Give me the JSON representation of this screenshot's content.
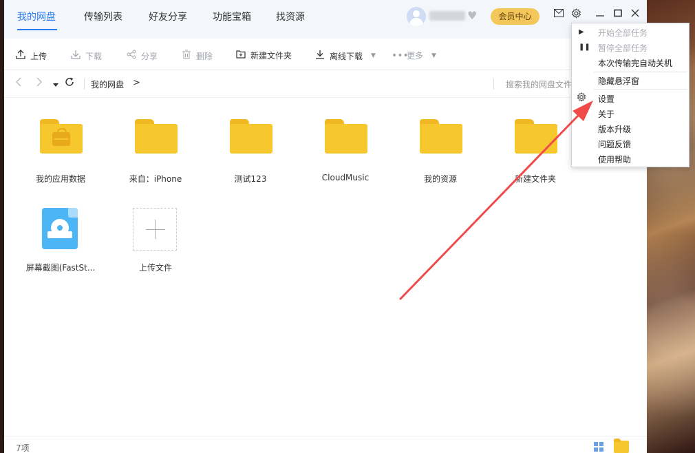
{
  "nav": {
    "tabs": [
      {
        "label": "我的网盘"
      },
      {
        "label": "传输列表"
      },
      {
        "label": "好友分享"
      },
      {
        "label": "功能宝箱"
      },
      {
        "label": "找资源"
      }
    ],
    "member_center": "会员中心"
  },
  "toolbar": {
    "upload": "上传",
    "download": "下载",
    "share": "分享",
    "delete": "删除",
    "new_folder": "新建文件夹",
    "offline_download": "离线下载",
    "more": "更多"
  },
  "pathbar": {
    "crumb": "我的网盘",
    "crumb_arrow": ">",
    "search_placeholder": "搜索我的网盘文件"
  },
  "files": [
    {
      "name": "我的应用数据",
      "type": "app-folder"
    },
    {
      "name": "来自：iPhone",
      "type": "folder"
    },
    {
      "name": "测试123",
      "type": "folder"
    },
    {
      "name": "CloudMusic",
      "type": "folder"
    },
    {
      "name": "我的资源",
      "type": "folder"
    },
    {
      "name": "新建文件夹",
      "type": "folder"
    },
    {
      "name": "屏幕截图(FastSt...",
      "type": "file"
    },
    {
      "name": "上传文件",
      "type": "upload"
    }
  ],
  "status": {
    "count": "7项"
  },
  "menu": {
    "items": [
      {
        "label": "开始全部任务",
        "disabled": true
      },
      {
        "label": "暂停全部任务",
        "disabled": true
      },
      {
        "label": "本次传输完自动关机",
        "disabled": false
      },
      {
        "label": "隐藏悬浮窗",
        "disabled": false
      },
      {
        "label": "设置",
        "disabled": false
      },
      {
        "label": "关于",
        "disabled": false
      },
      {
        "label": "版本升级",
        "disabled": false
      },
      {
        "label": "问题反馈",
        "disabled": false
      },
      {
        "label": "使用帮助",
        "disabled": false
      }
    ]
  },
  "colors": {
    "accent": "#2b7cf3",
    "folder": "#f7c72e",
    "member_button": "#f3c75a",
    "annotation_arrow": "#f04b4b"
  }
}
